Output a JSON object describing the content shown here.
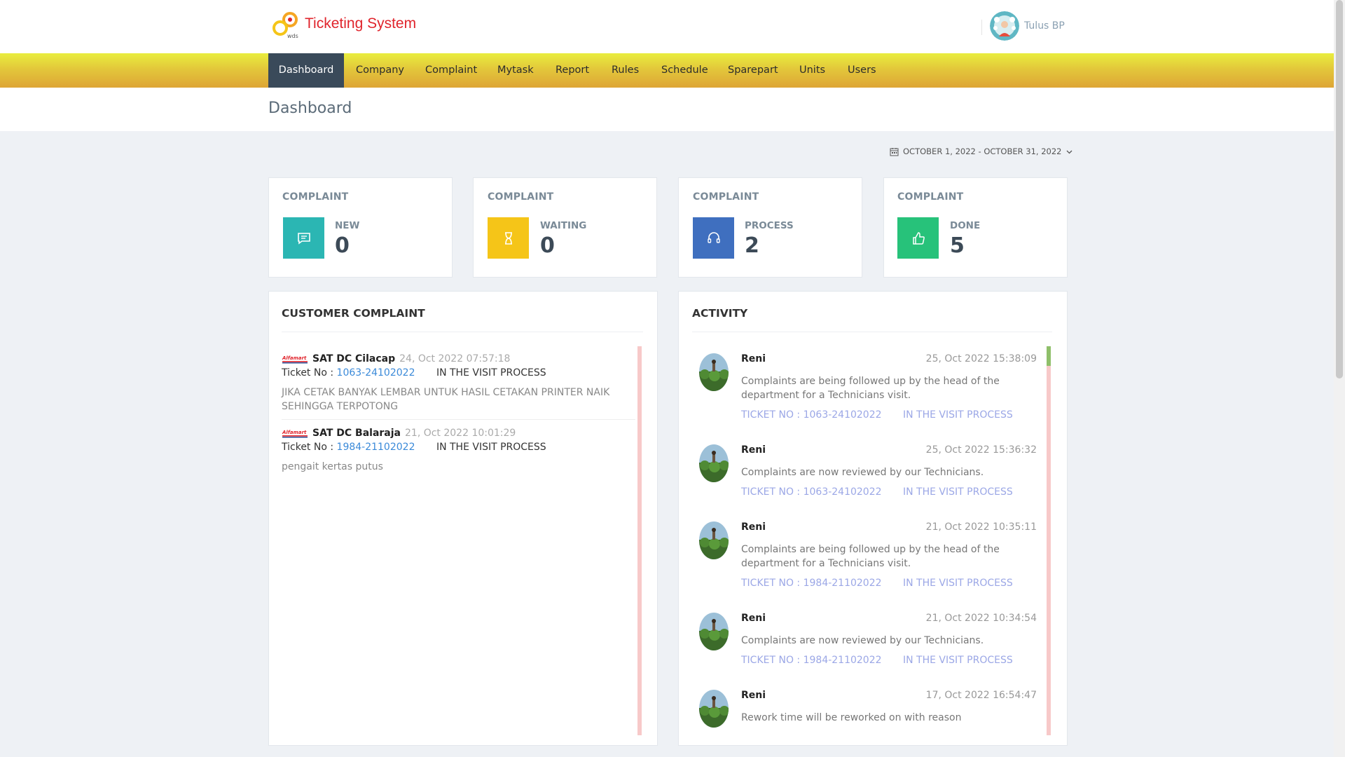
{
  "app": {
    "title": "Ticketing System",
    "logo_text": "wds"
  },
  "user": {
    "name": "Tulus BP"
  },
  "nav": {
    "items": [
      {
        "label": "Dashboard"
      },
      {
        "label": "Company"
      },
      {
        "label": "Complaint"
      },
      {
        "label": "Mytask"
      },
      {
        "label": "Report"
      },
      {
        "label": "Rules"
      },
      {
        "label": "Schedule"
      },
      {
        "label": "Sparepart"
      },
      {
        "label": "Units"
      },
      {
        "label": "Users"
      }
    ],
    "active": "Dashboard"
  },
  "page": {
    "title": "Dashboard"
  },
  "date_range": {
    "label": "OCTOBER 1, 2022 - OCTOBER 31, 2022"
  },
  "stats": [
    {
      "caption": "COMPLAINT",
      "label": "NEW",
      "value": "0",
      "color": "#2bb6b3",
      "icon": "message-icon"
    },
    {
      "caption": "COMPLAINT",
      "label": "WAITING",
      "value": "0",
      "color": "#f5c518",
      "icon": "hourglass-icon"
    },
    {
      "caption": "COMPLAINT",
      "label": "PROCESS",
      "value": "2",
      "color": "#3f6fbf",
      "icon": "headset-icon"
    },
    {
      "caption": "COMPLAINT",
      "label": "DONE",
      "value": "5",
      "color": "#27c27a",
      "icon": "thumbs-up-icon"
    }
  ],
  "customer_complaint": {
    "title": "CUSTOMER COMPLAINT",
    "ticket_prefix": "Ticket No :",
    "brand_logo": "Alfamart",
    "items": [
      {
        "site": "SAT DC Cilacap",
        "timestamp": "24, Oct 2022 07:57:18",
        "ticket": "1063-24102022",
        "status": "IN THE VISIT PROCESS",
        "description": "JIKA CETAK BANYAK LEMBAR UNTUK HASIL CETAKAN PRINTER NAIK SEHINGGA TERPOTONG"
      },
      {
        "site": "SAT DC Balaraja",
        "timestamp": "21, Oct 2022 10:01:29",
        "ticket": "1984-21102022",
        "status": "IN THE VISIT PROCESS",
        "description": "pengait kertas putus"
      }
    ]
  },
  "activity": {
    "title": "ACTIVITY",
    "items": [
      {
        "name": "Reni",
        "datetime": "25, Oct 2022 15:38:09",
        "message": "Complaints are being followed up by the head of the department for a Technicians visit.",
        "ticket": "TICKET NO : 1063-24102022",
        "status": "IN THE VISIT PROCESS"
      },
      {
        "name": "Reni",
        "datetime": "25, Oct 2022 15:36:32",
        "message": "Complaints are now reviewed by our Technicians.",
        "ticket": "TICKET NO : 1063-24102022",
        "status": "IN THE VISIT PROCESS"
      },
      {
        "name": "Reni",
        "datetime": "21, Oct 2022 10:35:11",
        "message": "Complaints are being followed up by the head of the department for a Technicians visit.",
        "ticket": "TICKET NO : 1984-21102022",
        "status": "IN THE VISIT PROCESS"
      },
      {
        "name": "Reni",
        "datetime": "21, Oct 2022 10:34:54",
        "message": "Complaints are now reviewed by our Technicians.",
        "ticket": "TICKET NO : 1984-21102022",
        "status": "IN THE VISIT PROCESS"
      },
      {
        "name": "Reni",
        "datetime": "17, Oct 2022 16:54:47",
        "message": "Rework time will be reworked on with reason",
        "ticket": "",
        "status": ""
      }
    ]
  }
}
